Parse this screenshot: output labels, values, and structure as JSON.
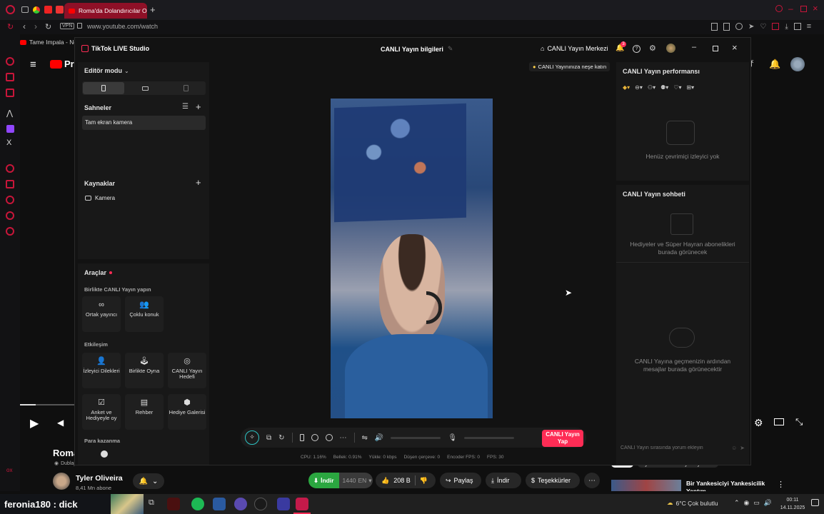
{
  "browser": {
    "tab_title": "Roma'da Dolandırıcılar O",
    "url": "www.youtube.com/watch",
    "vpn_label": "VPN",
    "bookmark": "Tame Impala - Ne"
  },
  "youtube": {
    "logo_text": "Pre",
    "video_title": "Roma",
    "dub_label": "Dublaj",
    "channel_name": "Tyler Oliveira",
    "subscribers": "8,41 Mn abone",
    "download_label": "İndir",
    "quality_label": "1440",
    "lang_label": "EN",
    "likes": "208 B",
    "share_label": "Paylaş",
    "download2_label": "İndir",
    "thanks_label": "Teşekkürler",
    "suggested_title": "Bir Yankesiciyi Yankesicilik Yaptım",
    "chip_all": "Tümü",
    "chip_channel": "Tyler Oliveira adlı yükleyiciden"
  },
  "tiktok": {
    "app_title": "TikTok LIVE Studio",
    "center_title": "CANLI Yayın bilgileri",
    "live_center": "CANLI Yayın Merkezi",
    "notif_count": "3",
    "editor_mode": "Editör modu",
    "scenes_title": "Sahneler",
    "scene_item": "Tam ekran kamera",
    "sources_title": "Kaynaklar",
    "source_item": "Kamera",
    "tools_title": "Araçlar",
    "collab_title": "Birlikte CANLI Yayın yapın",
    "tools_collab": [
      {
        "label": "Ortak yayıncı",
        "icon": "link-icon"
      },
      {
        "label": "Çoklu konuk",
        "icon": "users-icon"
      }
    ],
    "interaction_title": "Etkileşim",
    "tools_interaction": [
      {
        "label": "İzleyici Dilekleri",
        "icon": "wish-icon"
      },
      {
        "label": "Birlikte Oyna",
        "icon": "joystick-icon"
      },
      {
        "label": "CANLI Yayın Hedefi",
        "icon": "target-icon"
      },
      {
        "label": "Anket ve Hediyeyle oy",
        "icon": "poll-icon"
      },
      {
        "label": "Rehber",
        "icon": "guide-icon"
      },
      {
        "label": "Hediye Galerisi",
        "icon": "gift-icon"
      }
    ],
    "earn_title": "Para kazanma",
    "tip": "CANLI Yayınınıza neşe katın",
    "perf_title": "CANLI Yayın performansı",
    "no_viewers": "Henüz çevrimiçi izleyici yok",
    "chat_title": "CANLI Yayın sohbeti",
    "gifts_msg": "Hediyeler ve Süper Hayran abonelikleri burada görünecek",
    "messages_msg": "CANLI Yayına geçmenizin ardından mesajlar burada görünecektir",
    "chat_placeholder": "CANLI Yayın sırasında yorum ekleyin",
    "go_live": "CANLI Yayın Yap",
    "stats": {
      "cpu": "CPU: 1.16%",
      "memory": "Bellek: 0.91%",
      "upload": "Yükle: 0 kbps",
      "dropped": "Düşen çerçeve: 0",
      "encoder": "Encoder FPS: 0",
      "fps": "FPS: 30"
    }
  },
  "taskbar": {
    "overlay_text": "feronia180 : dick",
    "weather": "6°C  Çok bulutlu",
    "time": "00:11",
    "date": "14.11.2025"
  },
  "colors": {
    "accent_pink": "#fe2c55",
    "opera_red": "#c8163a",
    "yt_red": "#ff0000",
    "download_green": "#2ba640"
  }
}
